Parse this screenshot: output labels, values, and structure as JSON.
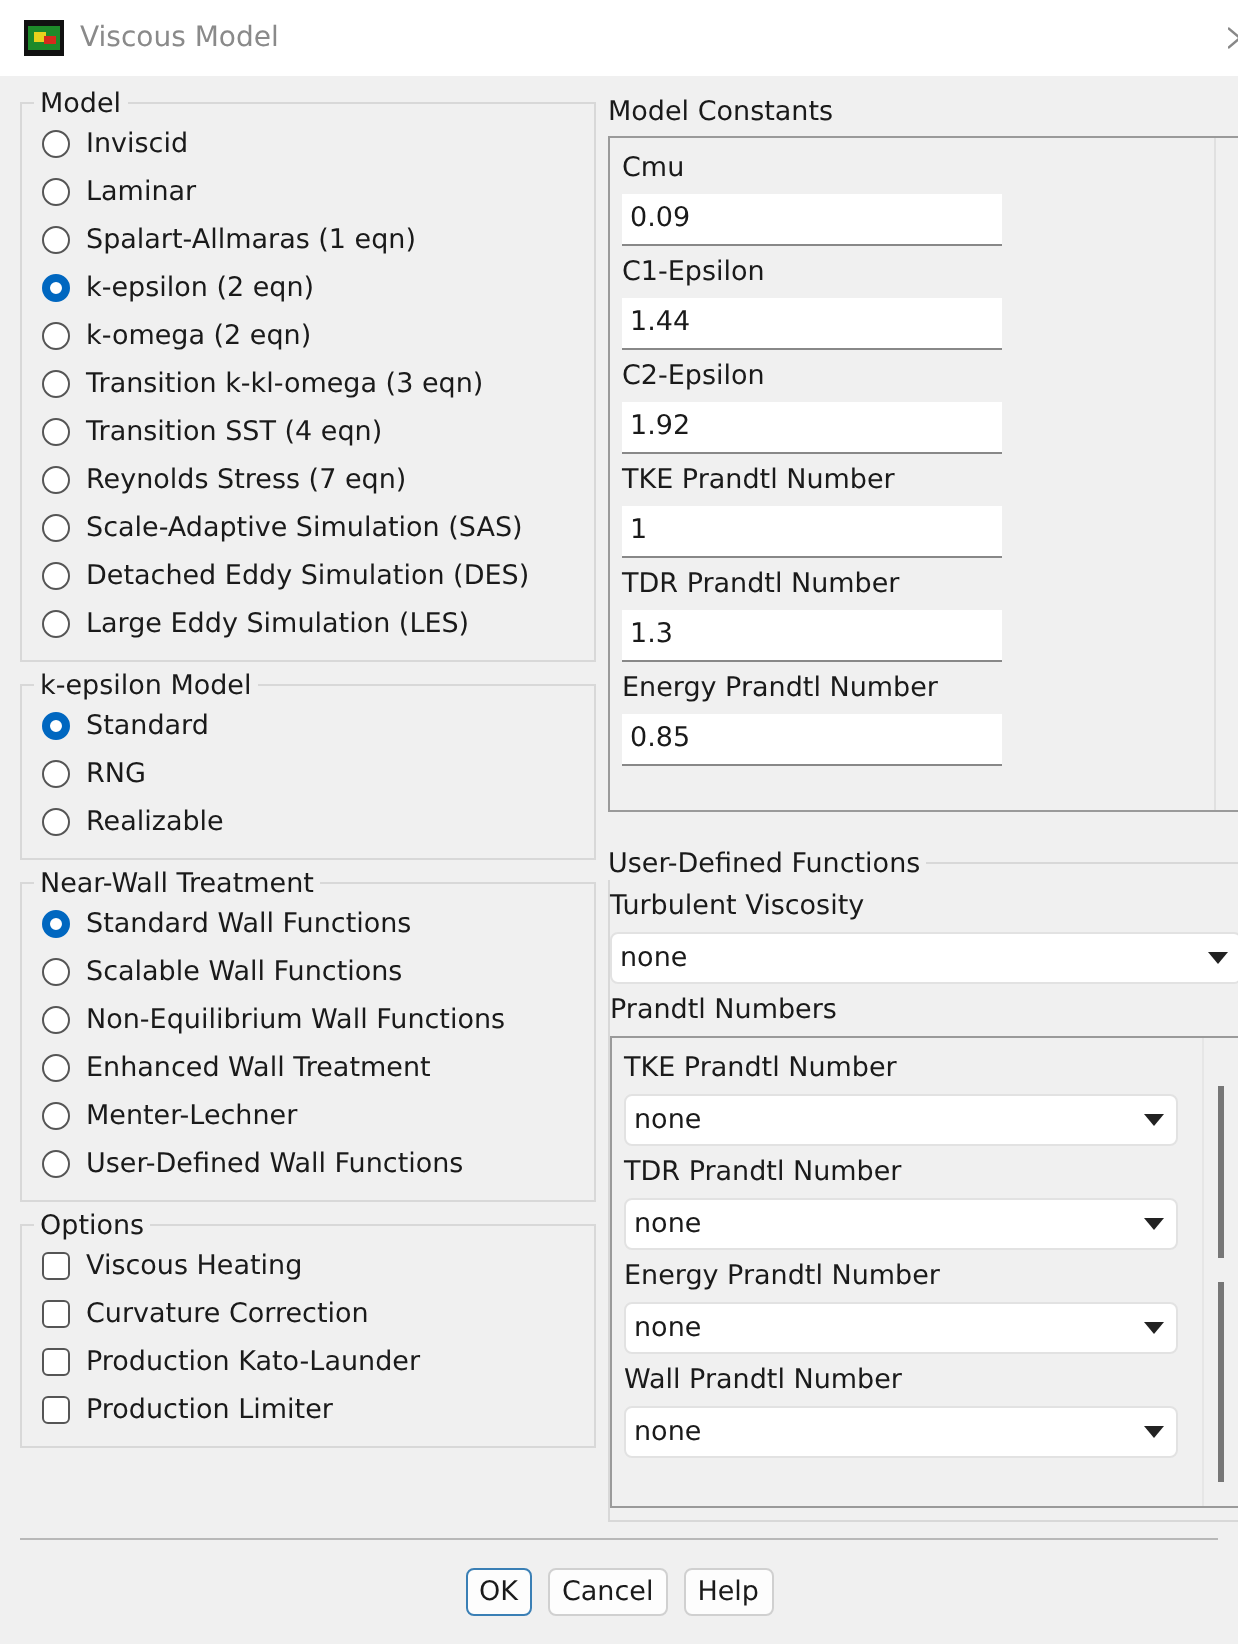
{
  "window": {
    "title": "Viscous Model"
  },
  "model": {
    "title": "Model",
    "options": [
      {
        "label": "Inviscid",
        "selected": false
      },
      {
        "label": "Laminar",
        "selected": false
      },
      {
        "label": "Spalart-Allmaras (1 eqn)",
        "selected": false
      },
      {
        "label": "k-epsilon (2 eqn)",
        "selected": true
      },
      {
        "label": "k-omega (2 eqn)",
        "selected": false
      },
      {
        "label": "Transition k-kl-omega (3 eqn)",
        "selected": false
      },
      {
        "label": "Transition SST (4 eqn)",
        "selected": false
      },
      {
        "label": "Reynolds Stress (7 eqn)",
        "selected": false
      },
      {
        "label": "Scale-Adaptive Simulation (SAS)",
        "selected": false
      },
      {
        "label": "Detached Eddy Simulation (DES)",
        "selected": false
      },
      {
        "label": "Large Eddy Simulation (LES)",
        "selected": false
      }
    ]
  },
  "k_epsilon_model": {
    "title": "k-epsilon Model",
    "options": [
      {
        "label": "Standard",
        "selected": true
      },
      {
        "label": "RNG",
        "selected": false
      },
      {
        "label": "Realizable",
        "selected": false
      }
    ]
  },
  "near_wall_treatment": {
    "title": "Near-Wall Treatment",
    "options": [
      {
        "label": "Standard Wall Functions",
        "selected": true
      },
      {
        "label": "Scalable Wall Functions",
        "selected": false
      },
      {
        "label": "Non-Equilibrium Wall Functions",
        "selected": false
      },
      {
        "label": "Enhanced Wall Treatment",
        "selected": false
      },
      {
        "label": "Menter-Lechner",
        "selected": false
      },
      {
        "label": "User-Defined Wall Functions",
        "selected": false
      }
    ]
  },
  "options": {
    "title": "Options",
    "items": [
      {
        "label": "Viscous Heating",
        "checked": false
      },
      {
        "label": "Curvature Correction",
        "checked": false
      },
      {
        "label": "Production Kato-Launder",
        "checked": false
      },
      {
        "label": "Production Limiter",
        "checked": false
      }
    ]
  },
  "model_constants": {
    "title": "Model Constants",
    "fields": [
      {
        "label": "Cmu",
        "value": "0.09"
      },
      {
        "label": "C1-Epsilon",
        "value": "1.44"
      },
      {
        "label": "C2-Epsilon",
        "value": "1.92"
      },
      {
        "label": "TKE Prandtl Number",
        "value": "1"
      },
      {
        "label": "TDR Prandtl Number",
        "value": "1.3"
      },
      {
        "label": "Energy Prandtl Number",
        "value": "0.85"
      }
    ]
  },
  "user_defined_functions": {
    "title": "User-Defined Functions",
    "turbulent_viscosity": {
      "label": "Turbulent Viscosity",
      "value": "none"
    },
    "prandtl_numbers": {
      "title": "Prandtl Numbers",
      "items": [
        {
          "label": "TKE Prandtl Number",
          "value": "none"
        },
        {
          "label": "TDR Prandtl Number",
          "value": "none"
        },
        {
          "label": "Energy Prandtl Number",
          "value": "none"
        },
        {
          "label": "Wall Prandtl Number",
          "value": "none"
        }
      ]
    }
  },
  "buttons": [
    {
      "label": "OK",
      "focused": true
    },
    {
      "label": "Cancel",
      "focused": false
    },
    {
      "label": "Help",
      "focused": false
    }
  ]
}
